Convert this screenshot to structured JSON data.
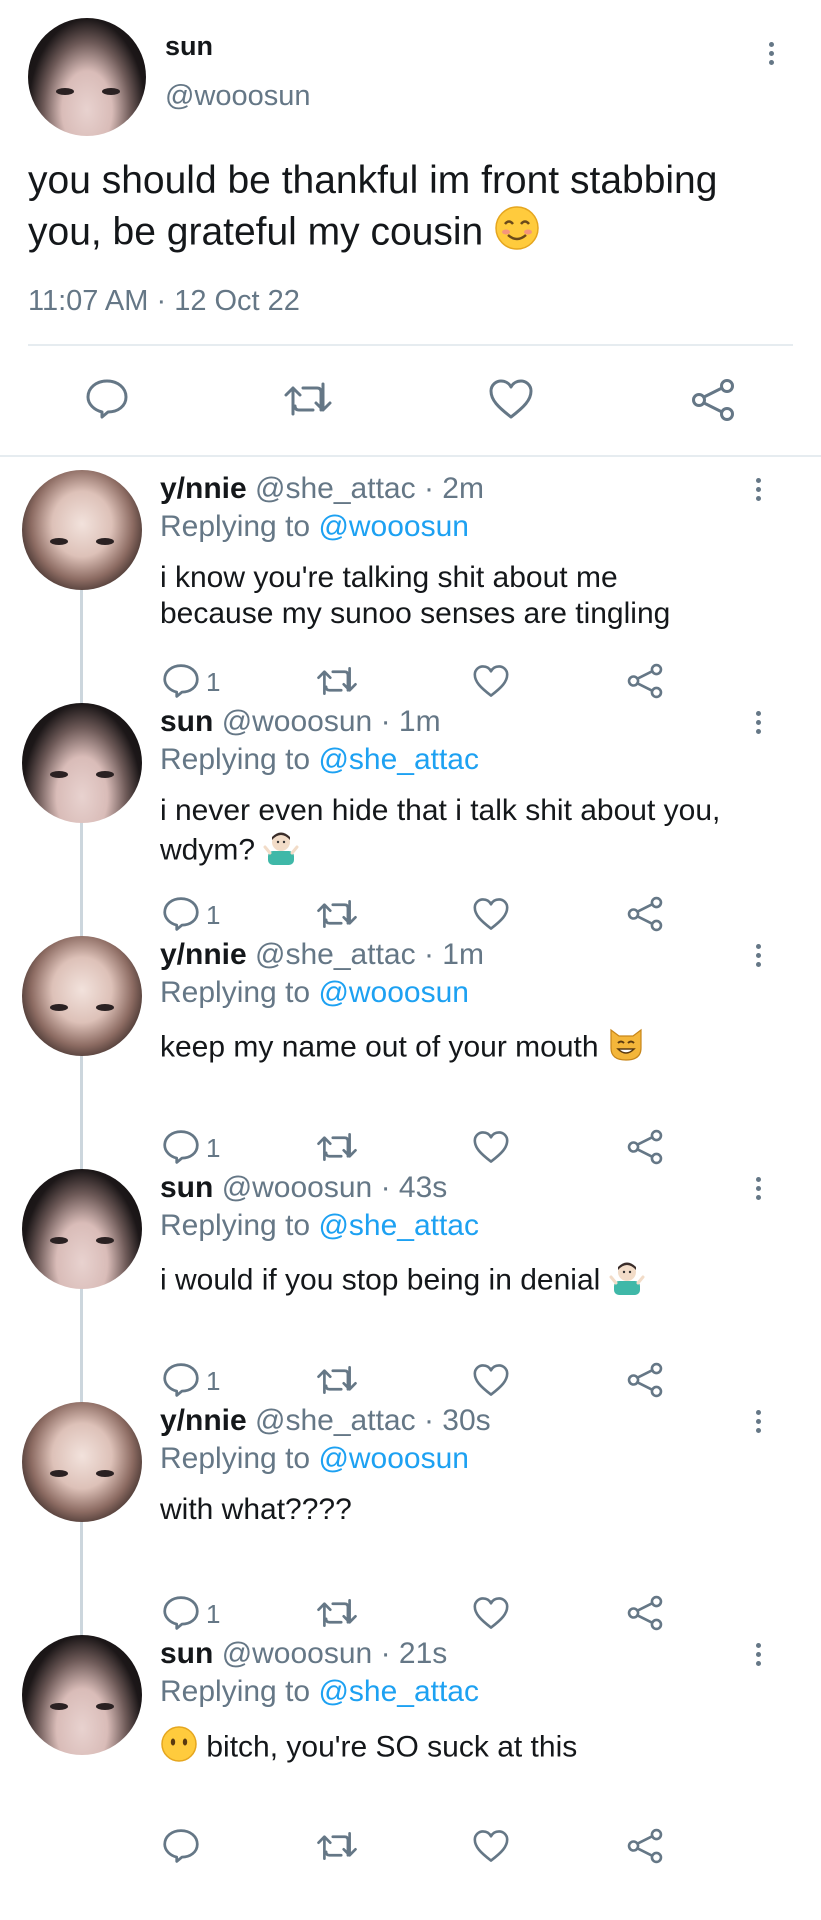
{
  "main_tweet": {
    "name": "sun",
    "handle": "@wooosun",
    "text": "you should be thankful im front stabbing you, be grateful my cousin",
    "emoji": "smiling-face-with-smiling-eyes",
    "time": "11:07 AM",
    "separator": "·",
    "date": "12 Oct 22"
  },
  "replies": [
    {
      "name": "y/nnie",
      "handle": "@she_attac",
      "age": "· 2m",
      "replying_label": "Replying to",
      "replying_to": "@wooosun",
      "text_lines": [
        "i know you're talking shit about me",
        "because my sunoo senses are tingling"
      ],
      "emoji": "",
      "reply_count": "1",
      "avatar": "ynnie"
    },
    {
      "name": "sun",
      "handle": "@wooosun",
      "age": "· 1m",
      "replying_label": "Replying to",
      "replying_to": "@she_attac",
      "text_lines": [
        "i never even hide that i talk shit about you,",
        "wdym?"
      ],
      "emoji": "person-shrugging",
      "reply_count": "1",
      "avatar": "sun"
    },
    {
      "name": "y/nnie",
      "handle": "@she_attac",
      "age": "· 1m",
      "replying_label": "Replying to",
      "replying_to": "@wooosun",
      "text_lines": [
        "keep my name out of your mouth"
      ],
      "emoji": "grinning-cat",
      "reply_count": "1",
      "avatar": "ynnie"
    },
    {
      "name": "sun",
      "handle": "@wooosun",
      "age": "· 43s",
      "replying_label": "Replying to",
      "replying_to": "@she_attac",
      "text_lines": [
        "i would if you stop being in denial"
      ],
      "emoji": "person-shrugging",
      "reply_count": "1",
      "avatar": "sun"
    },
    {
      "name": "y/nnie",
      "handle": "@she_attac",
      "age": "· 30s",
      "replying_label": "Replying to",
      "replying_to": "@wooosun",
      "text_lines": [
        "with what????"
      ],
      "emoji": "",
      "reply_count": "1",
      "avatar": "ynnie"
    },
    {
      "name": "sun",
      "handle": "@wooosun",
      "age": "· 21s",
      "replying_label": "Replying to",
      "replying_to": "@she_attac",
      "text_lines": [
        "bitch, you're SO suck at this"
      ],
      "emoji": "face-without-mouth",
      "reply_count": "",
      "avatar": "sun"
    }
  ],
  "colors": {
    "text": "#14171a",
    "secondary": "#657786",
    "link": "#1da1f2",
    "divider": "#e6ecf0"
  },
  "icons": [
    "reply-icon",
    "retweet-icon",
    "like-icon",
    "share-icon",
    "more-icon"
  ]
}
